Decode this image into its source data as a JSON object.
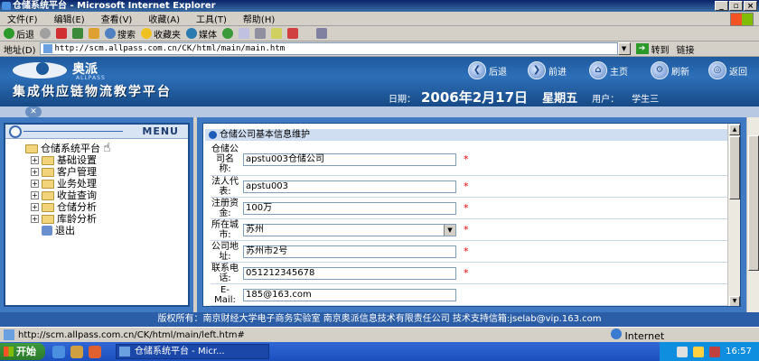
{
  "window": {
    "title": "仓储系统平台 - Microsoft Internet Explorer",
    "controls": [
      "_",
      "▫",
      "×"
    ]
  },
  "menubar": {
    "items": [
      "文件(F)",
      "编辑(E)",
      "查看(V)",
      "收藏(A)",
      "工具(T)",
      "帮助(H)"
    ]
  },
  "toolbar": {
    "back": "后退",
    "search": "搜索",
    "favorites": "收藏夹",
    "media": "媒体"
  },
  "address": {
    "label": "地址(D)",
    "url": "http://scm.allpass.com.cn/CK/html/main/main.htm",
    "go": "转到",
    "links": "链接"
  },
  "banner": {
    "brand": "奥派",
    "brand_en": "ALLPASS",
    "platform": "集成供应链物流教学平台",
    "nav": {
      "back": "后退",
      "forward": "前进",
      "home": "主页",
      "refresh": "刷新",
      "return": "返回"
    },
    "date_label": "日期：",
    "date": "2006年2月17日",
    "weekday": "星期五",
    "user_label": "用户：",
    "user": "学生三"
  },
  "menu": {
    "header": "MENU",
    "root": "仓储系统平台",
    "items": [
      "基础设置",
      "客户管理",
      "业务处理",
      "收益查询",
      "仓储分析",
      "库龄分析"
    ],
    "exit": "退出"
  },
  "form": {
    "title": "仓储公司基本信息维护",
    "fields": [
      {
        "label": "仓储公司名称:",
        "value": "apstu003仓储公司",
        "required": "*"
      },
      {
        "label": "法人代表:",
        "value": "apstu003",
        "required": "*"
      },
      {
        "label": "注册资金:",
        "value": "100万",
        "required": "*"
      },
      {
        "label": "所在城市:",
        "value": "苏州",
        "required": "*"
      },
      {
        "label": "公司地址:",
        "value": "苏州市2号",
        "required": "*"
      },
      {
        "label": "联系电话:",
        "value": "051212345678",
        "required": "*"
      },
      {
        "label": "E-Mail:",
        "value": "185@163.com",
        "required": ""
      }
    ]
  },
  "footer": {
    "text": "版权所有：南京财经大学电子商务实验室  南京奥派信息技术有限责任公司  技术支持信箱:jselab@vip.163.com"
  },
  "status": {
    "url": "http://scm.allpass.com.cn/CK/html/main/left.htm#",
    "zone": "Internet"
  },
  "taskbar": {
    "start": "开始",
    "task": "仓储系统平台 - Micr...",
    "time": "16:57"
  }
}
